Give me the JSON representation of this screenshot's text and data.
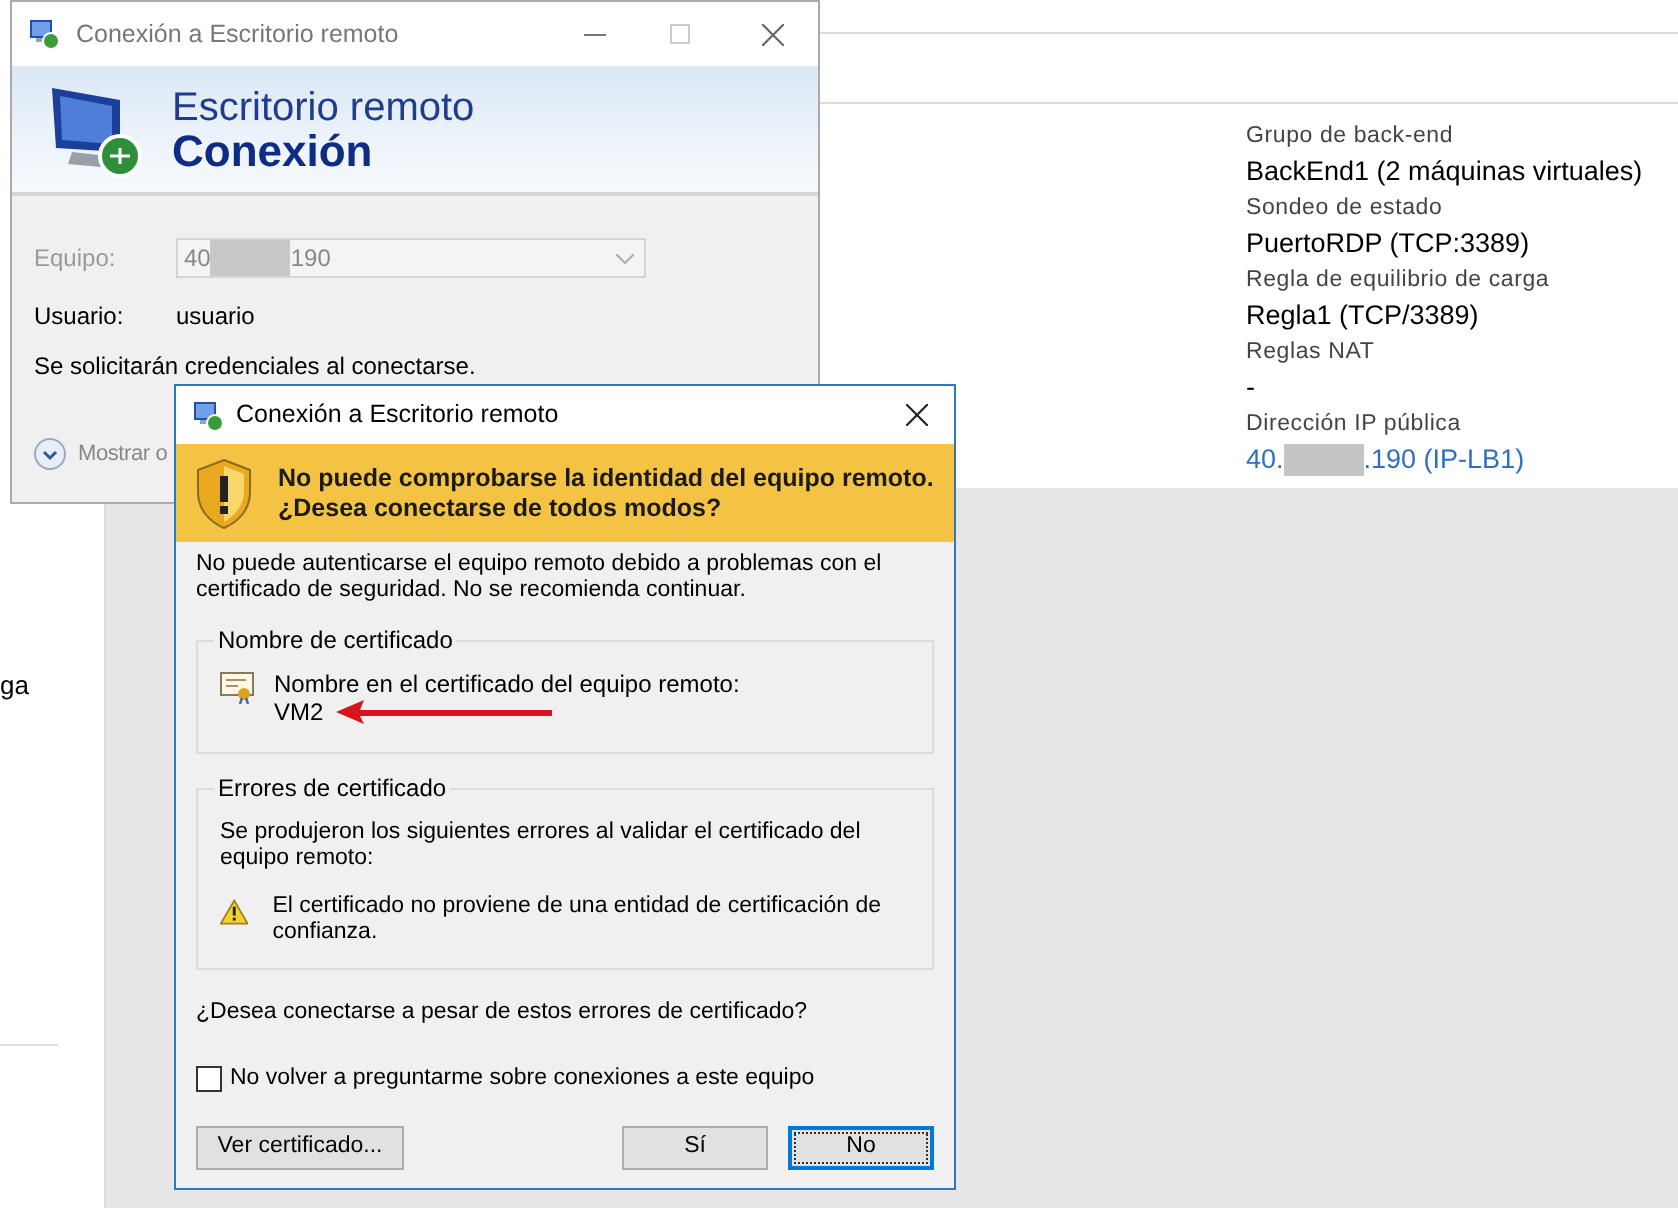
{
  "background_page": {
    "side_fragment": "ga",
    "details": [
      {
        "label": "Grupo de back-end",
        "kind": "text",
        "value": "BackEnd1 (2 máquinas virtuales)"
      },
      {
        "label": "Sondeo de estado",
        "kind": "text",
        "value": "PuertoRDP (TCP:3389)"
      },
      {
        "label": "Regla de equilibrio de carga",
        "kind": "text",
        "value": "Regla1 (TCP/3389)"
      },
      {
        "label": "Reglas NAT",
        "kind": "text",
        "value": "-"
      },
      {
        "label": "Dirección IP pública",
        "kind": "redacted-link",
        "value_prefix": "40.",
        "value_suffix": ".190 (IP-LB1)"
      }
    ]
  },
  "main_window": {
    "title": "Conexión a Escritorio remoto",
    "heading_line1": "Escritorio remoto",
    "heading_line2": "Conexión",
    "computer": {
      "label": "Equipo:",
      "value_prefix": "40",
      "value_suffix": "190",
      "disabled": true
    },
    "user": {
      "label": "Usuario:",
      "value": "usuario"
    },
    "note": "Se solicitarán credenciales al conectarse.",
    "options_toggle": "Mostrar o"
  },
  "dialog": {
    "title": "Conexión a Escritorio remoto",
    "warning_line1": "No puede comprobarse la identidad del equipo remoto.",
    "warning_line2": "¿Desea conectarse de todos modos?",
    "message": "No puede autenticarse el equipo remoto debido a problemas con el certificado de seguridad. No se recomienda continuar.",
    "certificate_name": {
      "legend": "Nombre de certificado",
      "label": "Nombre en el certificado del equipo remoto:",
      "value": "VM2"
    },
    "certificate_errors": {
      "legend": "Errores de certificado",
      "intro": "Se produjeron los siguientes errores al validar el certificado del equipo remoto:",
      "errors": [
        "El certificado no proviene de una entidad de certificación de confianza."
      ]
    },
    "question": "¿Desea conectarse a pesar de estos errores de certificado?",
    "dont_ask": {
      "label": "No volver a preguntarme sobre conexiones a este equipo",
      "checked": false
    },
    "buttons": [
      {
        "label": "Ver certificado...",
        "default": false
      },
      {
        "label": "Sí",
        "default": false
      },
      {
        "label": "No",
        "default": true
      }
    ]
  }
}
